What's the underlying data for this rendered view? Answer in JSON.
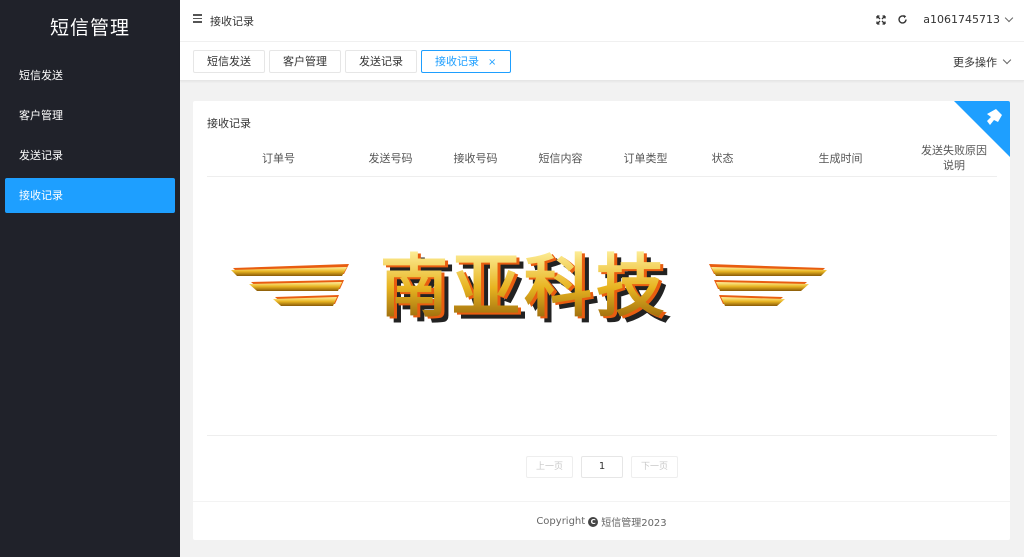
{
  "app": {
    "title": "短信管理"
  },
  "sidebar": {
    "items": [
      {
        "label": "短信发送",
        "active": false
      },
      {
        "label": "客户管理",
        "active": false
      },
      {
        "label": "发送记录",
        "active": false
      },
      {
        "label": "接收记录",
        "active": true
      }
    ]
  },
  "header": {
    "breadcrumb": "接收记录",
    "username": "a1061745713",
    "icons": [
      "menu-icon",
      "fullscreen-icon",
      "refresh-icon",
      "chevron-down-icon"
    ]
  },
  "tabs": {
    "items": [
      {
        "label": "短信发送"
      },
      {
        "label": "客户管理"
      },
      {
        "label": "发送记录"
      },
      {
        "label": "接收记录",
        "active": true,
        "close": "×"
      }
    ],
    "more_ops": "更多操作"
  },
  "card": {
    "title": "接收记录",
    "columns": [
      "订单号",
      "发送号码",
      "接收号码",
      "短信内容",
      "订单类型",
      "状态",
      "生成时间",
      "发送失败原因说明"
    ],
    "banner_text": "南亚科技",
    "pager": {
      "prev": "上一页",
      "page": "1",
      "next": "下一页"
    },
    "footer": {
      "copyright": "Copyright",
      "icon": "C",
      "text": "短信管理2023"
    }
  },
  "colors": {
    "accent": "#1e9fff",
    "sidebar_bg": "#20222a",
    "banner_gold": "#e8b421",
    "banner_orange": "#e85d10"
  }
}
